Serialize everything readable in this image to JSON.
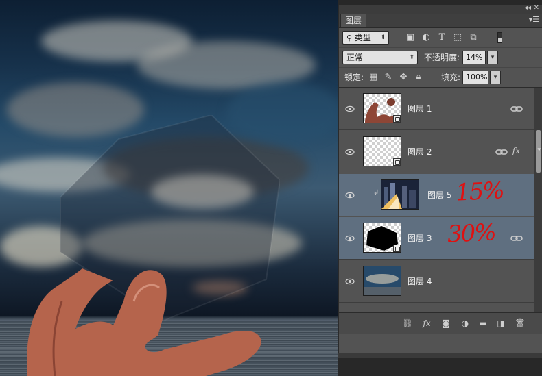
{
  "panel": {
    "tab_label": "图层",
    "collapse_icon": "double-chevron-icon",
    "menu_icon": "panel-menu-icon",
    "filter": {
      "kind_label": "类型",
      "icons": [
        "image-filter-icon",
        "adjustment-filter-icon",
        "type-filter-icon",
        "shape-filter-icon",
        "smart-object-filter-icon",
        "toggle-filter-icon"
      ]
    },
    "blend": {
      "mode": "正常",
      "opacity_label": "不透明度:",
      "opacity_value": "14%"
    },
    "lock": {
      "label": "锁定:",
      "fill_label": "填充:",
      "fill_value": "100%"
    }
  },
  "layers": [
    {
      "name": "图层 1",
      "visible": true,
      "selected": false,
      "linked": true,
      "fx": false,
      "clipped": false,
      "smart_object": true,
      "note": ""
    },
    {
      "name": "图层 2",
      "visible": true,
      "selected": false,
      "linked": true,
      "fx": true,
      "clipped": false,
      "smart_object": true,
      "note": ""
    },
    {
      "name": "图层 5",
      "visible": true,
      "selected": true,
      "linked": false,
      "fx": false,
      "clipped": true,
      "smart_object": false,
      "note": "15%"
    },
    {
      "name": "图层 3",
      "visible": true,
      "selected": true,
      "linked": true,
      "fx": false,
      "clipped": false,
      "smart_object": true,
      "note": "30%"
    },
    {
      "name": "图层 4",
      "visible": true,
      "selected": false,
      "linked": false,
      "fx": false,
      "clipped": false,
      "smart_object": false,
      "note": ""
    }
  ],
  "bottom_bar": [
    "link-layers-icon",
    "fx-icon",
    "mask-icon",
    "adjustment-layer-icon",
    "group-folder-icon",
    "new-layer-icon",
    "delete-layer-icon"
  ],
  "colors": {
    "panel_bg": "#535353",
    "selection": "#5f6f80",
    "annotation": "#e01010"
  }
}
